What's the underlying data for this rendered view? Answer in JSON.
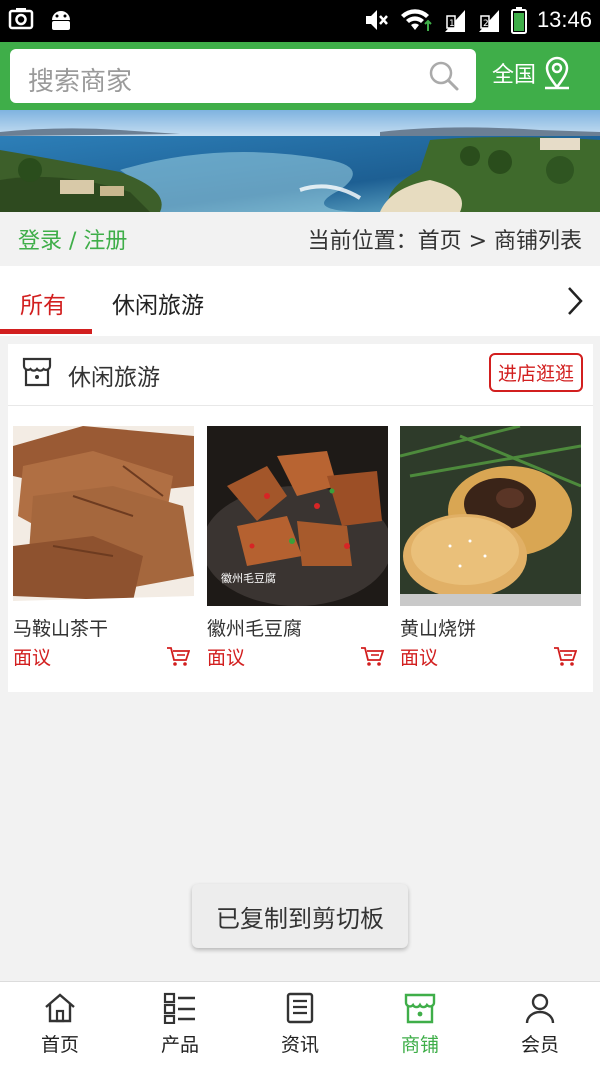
{
  "status_bar": {
    "time": "13:46"
  },
  "search": {
    "placeholder": "搜索商家"
  },
  "region": {
    "label": "全国"
  },
  "breadcrumb": {
    "login": "登录 / 注册",
    "location": "当前位置：首页 > 商铺列表"
  },
  "tabs": [
    {
      "label": "所有",
      "active": true
    },
    {
      "label": "休闲旅游",
      "active": false
    }
  ],
  "shop": {
    "name": "休闲旅游",
    "visit_label": "进店逛逛",
    "products": [
      {
        "name": "马鞍山茶干",
        "price": "面议"
      },
      {
        "name": "徽州毛豆腐",
        "price": "面议",
        "image_caption": "徽州毛豆腐"
      },
      {
        "name": "黄山烧饼",
        "price": "面议"
      }
    ]
  },
  "toast": {
    "message": "已复制到剪切板"
  },
  "nav": [
    {
      "label": "首页",
      "icon": "home-icon",
      "active": false
    },
    {
      "label": "产品",
      "icon": "product-list-icon",
      "active": false
    },
    {
      "label": "资讯",
      "icon": "news-icon",
      "active": false
    },
    {
      "label": "商铺",
      "icon": "shop-icon",
      "active": true
    },
    {
      "label": "会员",
      "icon": "member-icon",
      "active": false
    }
  ],
  "colors": {
    "brand_green": "#3fae49",
    "accent_red": "#d21f1f"
  }
}
